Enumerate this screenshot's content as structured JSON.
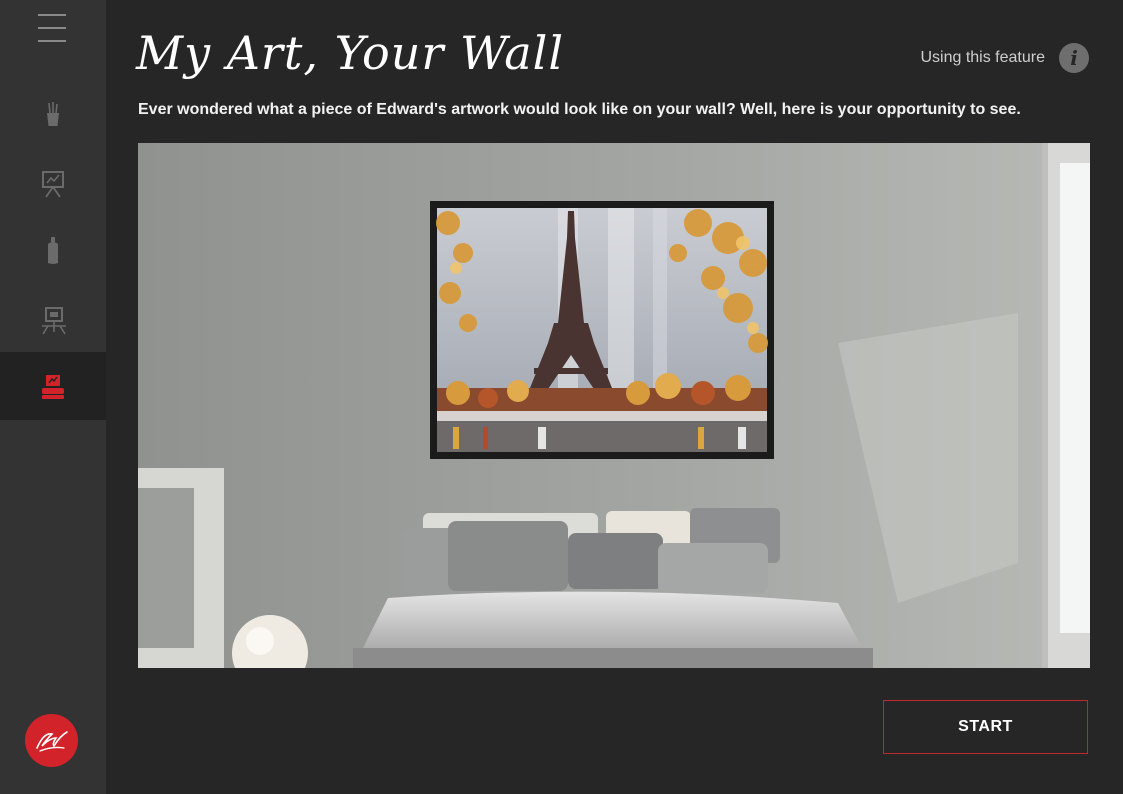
{
  "header": {
    "title": "My Art, Your Wall",
    "help_label": "Using this feature",
    "help_icon": "info-icon"
  },
  "intro_text": "Ever wondered what a piece of Edward's artwork would look like on your wall? Well, here is your opportunity to see.",
  "sidebar": {
    "menu_icon": "hamburger-icon",
    "items": [
      {
        "name": "brushes",
        "icon": "brush-cup-icon",
        "active": false
      },
      {
        "name": "presentation",
        "icon": "easel-board-icon",
        "active": false
      },
      {
        "name": "paint",
        "icon": "paint-tube-icon",
        "active": false
      },
      {
        "name": "gallery",
        "icon": "easel-stand-icon",
        "active": false
      },
      {
        "name": "my-art-your-wall",
        "icon": "sofa-art-icon",
        "active": true
      }
    ],
    "logo_icon": "signature-logo-icon"
  },
  "preview": {
    "scene": "bedroom wall with framed Eiffel Tower painting"
  },
  "actions": {
    "start_label": "START"
  },
  "colors": {
    "accent": "#c1272d",
    "background": "#262626",
    "sidebar": "#333333"
  }
}
